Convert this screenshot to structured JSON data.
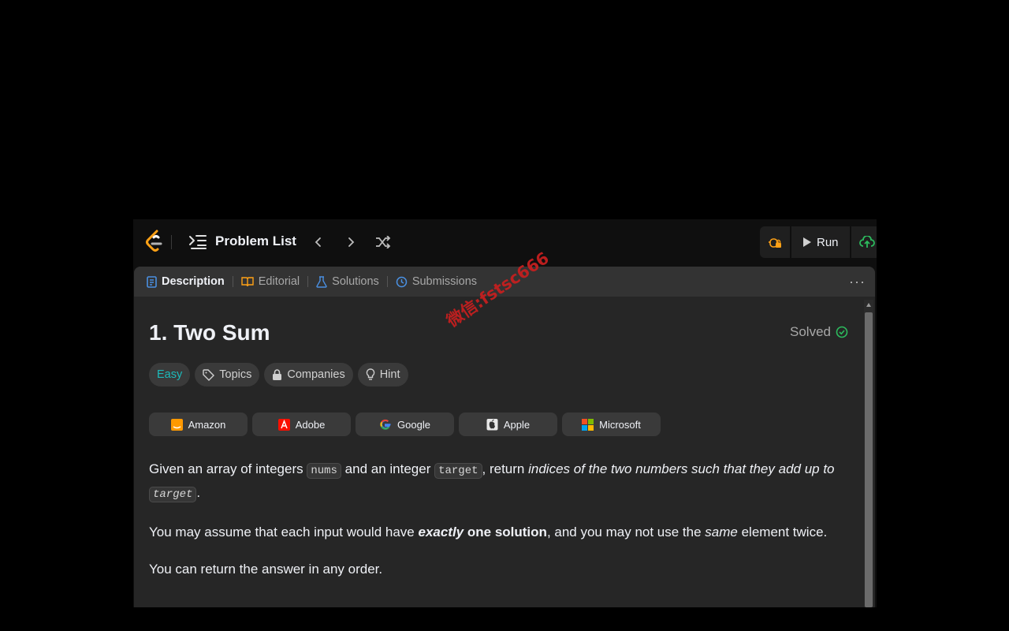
{
  "topbar": {
    "problem_list_label": "Problem List",
    "run_label": "Run"
  },
  "tabs": [
    {
      "label": "Description",
      "icon": "document-icon"
    },
    {
      "label": "Editorial",
      "icon": "book-icon"
    },
    {
      "label": "Solutions",
      "icon": "flask-icon"
    },
    {
      "label": "Submissions",
      "icon": "history-icon"
    }
  ],
  "problem": {
    "title": "1. Two Sum",
    "status": "Solved",
    "chips": {
      "difficulty": "Easy",
      "topics": "Topics",
      "companies": "Companies",
      "hint": "Hint"
    },
    "company_tags": [
      "Amazon",
      "Adobe",
      "Google",
      "Apple",
      "Microsoft"
    ],
    "desc": {
      "p1_a": "Given an array of integers ",
      "p1_code1": "nums",
      "p1_b": " and an integer ",
      "p1_code2": "target",
      "p1_c": ", return ",
      "p1_em": "indices of the two numbers such that they add up to",
      "p1_code3": "target",
      "p1_d": ".",
      "p2_a": "You may assume that each input would have ",
      "p2_em": "exactly",
      "p2_strong": " one solution",
      "p2_b": ", and you may not use the ",
      "p2_em2": "same",
      "p2_c": " element twice.",
      "p3": "You can return the answer in any order."
    }
  },
  "watermark": "微信:fstsc666",
  "colors": {
    "accent_easy": "#1cbaba",
    "solved_check": "#2cbb5d",
    "logo_orange": "#ffa116",
    "submit_green": "#2cbb5d"
  }
}
